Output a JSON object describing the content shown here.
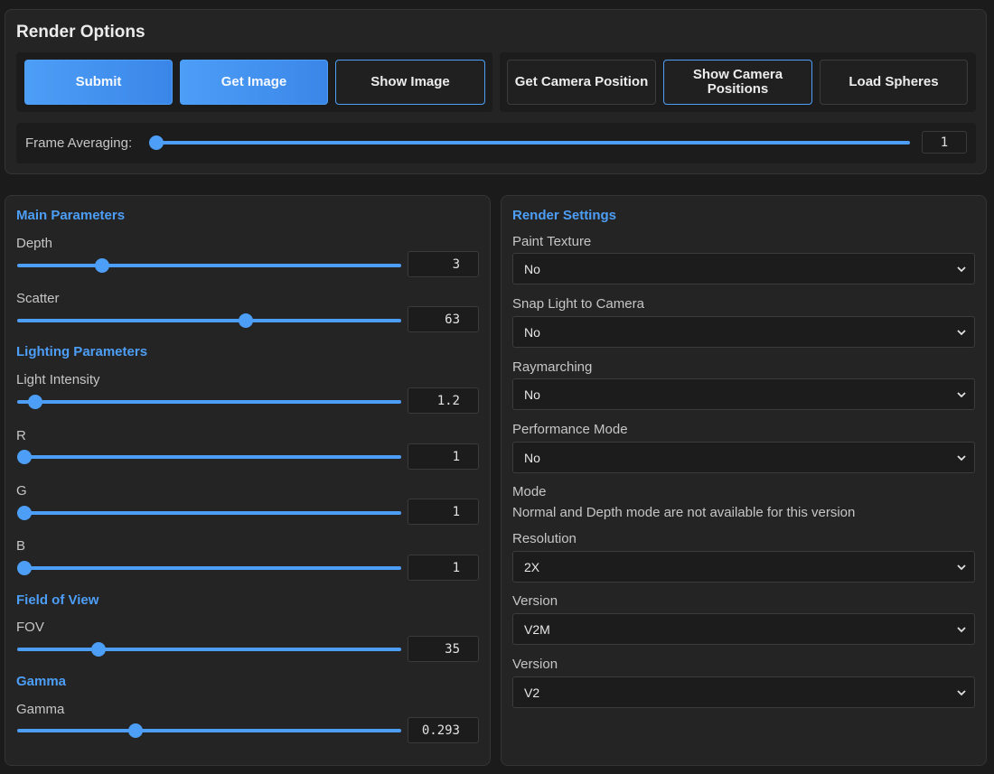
{
  "render_options": {
    "title": "Render Options",
    "buttons": {
      "submit": "Submit",
      "get_image": "Get Image",
      "show_image": "Show Image",
      "get_camera_position": "Get Camera Position",
      "show_camera_positions": "Show Camera Positions",
      "load_spheres": "Load Spheres"
    },
    "frame_averaging": {
      "label": "Frame Averaging:",
      "value": "1",
      "fraction": 0.0
    }
  },
  "main_parameters": {
    "title": "Main Parameters",
    "depth": {
      "label": "Depth",
      "value": "3",
      "fraction": 0.21
    },
    "scatter": {
      "label": "Scatter",
      "value": "63",
      "fraction": 0.6
    }
  },
  "lighting_parameters": {
    "title": "Lighting Parameters",
    "light_intensity": {
      "label": "Light Intensity",
      "value": "1.2",
      "fraction": 0.03
    },
    "r": {
      "label": "R",
      "value": "1",
      "fraction": 0.0
    },
    "g": {
      "label": "G",
      "value": "1",
      "fraction": 0.0
    },
    "b": {
      "label": "B",
      "value": "1",
      "fraction": 0.0
    }
  },
  "field_of_view": {
    "title": "Field of View",
    "fov": {
      "label": "FOV",
      "value": "35",
      "fraction": 0.2
    }
  },
  "gamma_section": {
    "title": "Gamma",
    "gamma": {
      "label": "Gamma",
      "value": "0.293",
      "fraction": 0.3
    }
  },
  "render_settings": {
    "title": "Render Settings",
    "paint_texture": {
      "label": "Paint Texture",
      "value": "No"
    },
    "snap_light": {
      "label": "Snap Light to Camera",
      "value": "No"
    },
    "raymarching": {
      "label": "Raymarching",
      "value": "No"
    },
    "performance_mode": {
      "label": "Performance Mode",
      "value": "No"
    },
    "mode": {
      "label": "Mode",
      "note": "Normal and Depth mode are not available for this version"
    },
    "resolution": {
      "label": "Resolution",
      "value": "2X"
    },
    "version_1": {
      "label": "Version",
      "value": "V2M"
    },
    "version_2": {
      "label": "Version",
      "value": "V2"
    }
  },
  "colors": {
    "accent": "#4d9ef7",
    "panel": "#242424",
    "background": "#1b1b1b"
  },
  "icons": {
    "select_arrow": "chevron-down-icon"
  }
}
